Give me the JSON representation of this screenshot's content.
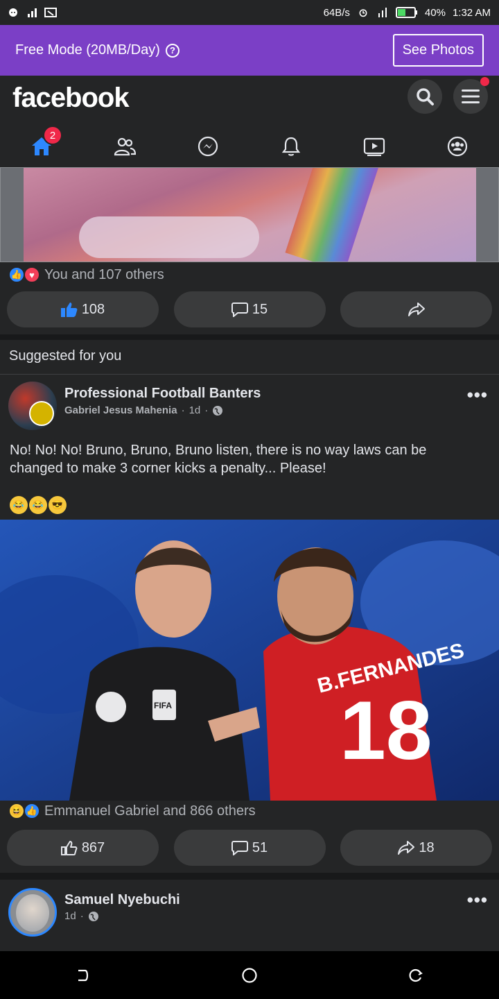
{
  "status_bar": {
    "speed": "64B/s",
    "battery": "40%",
    "time": "1:32 AM"
  },
  "free_mode": {
    "label": "Free Mode (20MB/Day)",
    "help": "?",
    "button": "See Photos"
  },
  "header": {
    "logo": "facebook",
    "home_badge": "2"
  },
  "post1": {
    "reactions_text": "You and 107 others",
    "like_count": "108",
    "comment_count": "15"
  },
  "suggested": {
    "label": "Suggested for you"
  },
  "post2": {
    "page_name": "Professional Football Banters",
    "author": "Gabriel Jesus Mahenia",
    "time": "1d",
    "text": "No! No! No! Bruno, Bruno, Bruno listen, there is no way laws can be changed to make 3 corner kicks a penalty... Please!",
    "photo": {
      "name_on_shirt": "B.FERNANDES",
      "shirt_number": "18",
      "badge": "FIFA"
    },
    "reactions_text": "Emmanuel Gabriel and 866 others",
    "like_count": "867",
    "comment_count": "51",
    "share_count": "18"
  },
  "post3": {
    "name": "Samuel Nyebuchi",
    "time": "1d"
  },
  "colors": {
    "banner": "#7b3fc6",
    "fb_blue": "#2d88ff",
    "badge_red": "#f02849"
  }
}
